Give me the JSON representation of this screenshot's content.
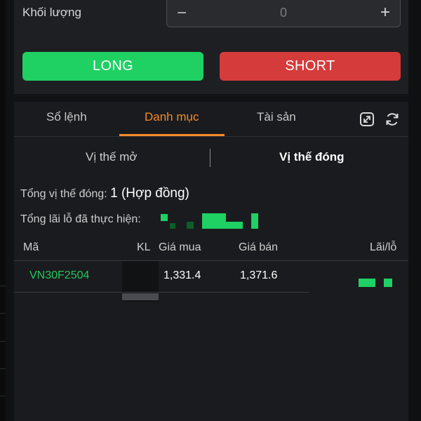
{
  "order": {
    "qty_label": "Khối lượng",
    "qty_minus": "−",
    "qty_value": "0",
    "qty_plus": "+",
    "long_label": "LONG",
    "short_label": "SHORT"
  },
  "tabs": {
    "orders": "Sổ lệnh",
    "portfolio": "Danh mục",
    "assets": "Tài sản",
    "active": "portfolio"
  },
  "icons": {
    "expand": "expand-icon",
    "refresh": "refresh-icon"
  },
  "subtabs": {
    "open": "Vị thế mở",
    "closed": "Vị thế đóng",
    "active": "closed"
  },
  "summary": {
    "closed_positions_label": "Tổng vị thế đóng:",
    "closed_positions_value": "1 (Hợp đồng)",
    "realized_pnl_label": "Tổng lãi lỗ đã thực hiện:"
  },
  "table": {
    "columns": [
      "Mã",
      "KL",
      "Giá mua",
      "Giá bán",
      "Lãi/lỗ"
    ],
    "rows": [
      {
        "code": "VN30F2504",
        "qty": "",
        "buy_price": "1,331.4",
        "sell_price": "1,371.6"
      }
    ]
  },
  "colors": {
    "long": "#1fd063",
    "short": "#d63b3b",
    "accent": "#f58a2c",
    "code": "#21c85e"
  }
}
